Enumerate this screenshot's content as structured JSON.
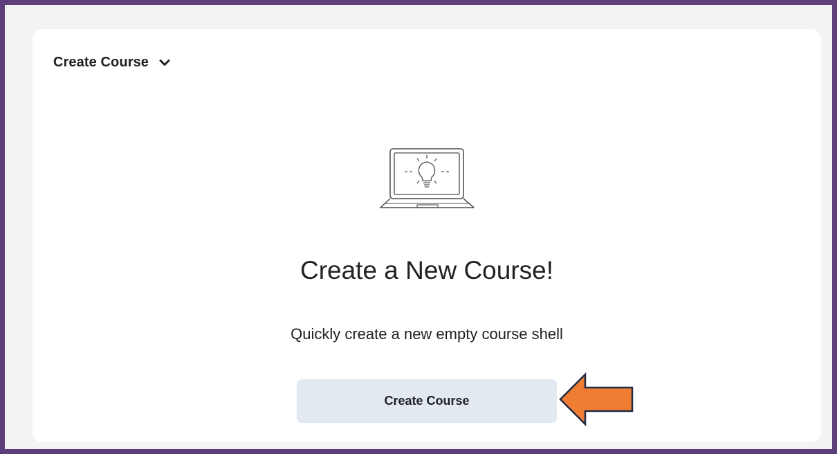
{
  "widget": {
    "title": "Create Course"
  },
  "main": {
    "heading": "Create a New Course!",
    "description": "Quickly create a new empty course shell",
    "button_label": "Create Course"
  },
  "icons": {
    "dropdown": "chevron-down-icon",
    "illustration": "laptop-lightbulb-icon",
    "annotation": "arrow-left-icon"
  },
  "colors": {
    "frame_border": "#5b3e7a",
    "background": "#f3f3f4",
    "card": "#ffffff",
    "button_bg": "#e3e9f1",
    "text": "#202122",
    "annotation_arrow": "#ef7d32",
    "annotation_outline": "#1f2a44"
  }
}
